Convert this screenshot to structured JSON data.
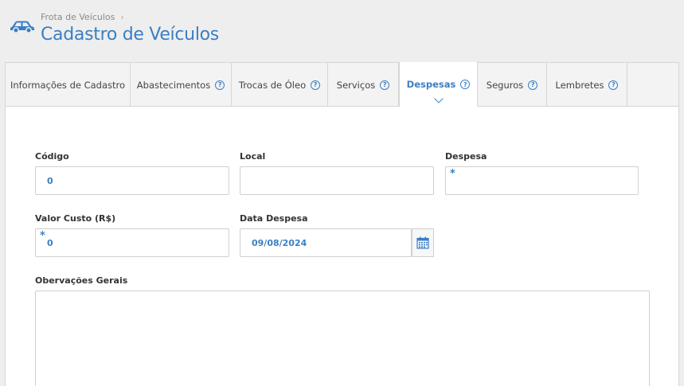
{
  "header": {
    "breadcrumb": "Frota de Veículos",
    "title": "Cadastro de Veículos"
  },
  "tabs": [
    {
      "label": "Informações de Cadastro",
      "help": false,
      "active": false
    },
    {
      "label": "Abastecimentos",
      "help": true,
      "active": false
    },
    {
      "label": "Trocas de Óleo",
      "help": true,
      "active": false
    },
    {
      "label": "Serviços",
      "help": true,
      "active": false
    },
    {
      "label": "Despesas",
      "help": true,
      "active": true
    },
    {
      "label": "Seguros",
      "help": true,
      "active": false
    },
    {
      "label": "Lembretes",
      "help": true,
      "active": false
    }
  ],
  "form": {
    "codigo": {
      "label": "Código",
      "value": "0"
    },
    "local": {
      "label": "Local",
      "value": ""
    },
    "despesa": {
      "label": "Despesa",
      "value": "",
      "required_mark": "*"
    },
    "valor_custo": {
      "label": "Valor Custo (R$)",
      "value": "0",
      "required_mark": "*"
    },
    "data_despesa": {
      "label": "Data Despesa",
      "value": "09/08/2024"
    },
    "observacoes": {
      "label": "Obervações Gerais",
      "value": ""
    }
  },
  "icons": {
    "header": "car-icon",
    "breadcrumb_separator": "chevron-right-icon",
    "tab_help": "help-circle-icon",
    "active_indicator": "chevron-down-icon",
    "date_picker": "calendar-icon"
  },
  "colors": {
    "accent": "#3a7fc4",
    "background": "#eeeeee",
    "panel": "#ffffff"
  }
}
